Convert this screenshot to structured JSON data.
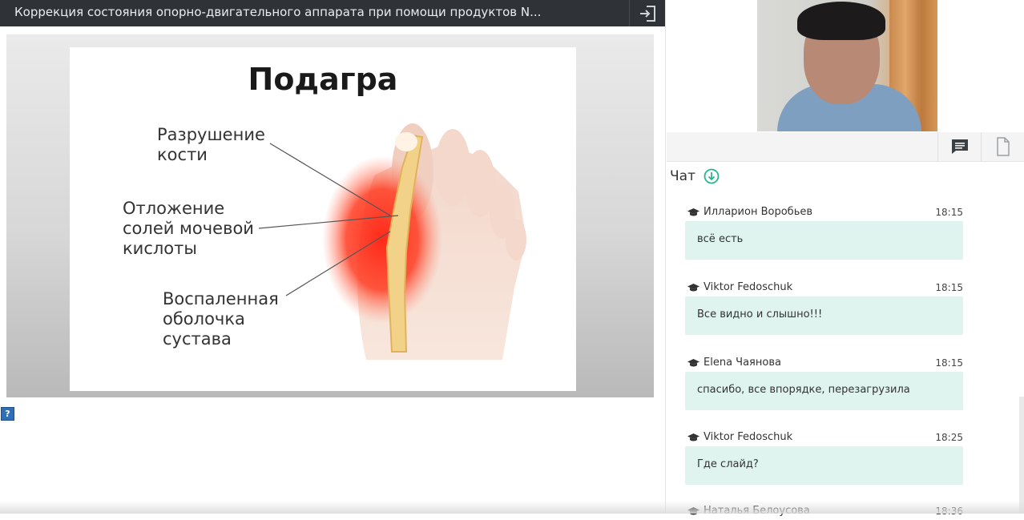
{
  "header": {
    "title": "Коррекция состояния опорно-двигательного аппарата при помощи продуктов N..."
  },
  "slide": {
    "title": "Подагра",
    "labels": {
      "bone": "Разрушение\nкости",
      "salts": "Отложение\nсолей мочевой\nкислоты",
      "membrane": "Воспаленная\nоболочка\nсустава"
    }
  },
  "help": {
    "label": "?"
  },
  "chat": {
    "title": "Чат",
    "messages": [
      {
        "author": "Илларион Воробьев",
        "time": "18:15",
        "text": "всё есть"
      },
      {
        "author": "Viktor Fedoschuk",
        "time": "18:15",
        "text": "Все видно и слышно!!!"
      },
      {
        "author": "Elena Чаянова",
        "time": "18:15",
        "text": "спасибо, все впорядке, перезагрузила"
      },
      {
        "author": "Viktor Fedoschuk",
        "time": "18:25",
        "text": "Где слайд?"
      },
      {
        "author": "Наталья Белоусова",
        "time": "18:36",
        "text": ""
      }
    ]
  },
  "colors": {
    "accent": "#2bb58e",
    "bubble": "#dff3ef",
    "topbar": "#2f3338"
  },
  "icons": {
    "exit": "sign-in-icon",
    "chat_tab": "chat-bubble-icon",
    "files_tab": "document-icon",
    "scroll": "arrow-down-circle-icon",
    "author": "graduation-cap-icon"
  }
}
